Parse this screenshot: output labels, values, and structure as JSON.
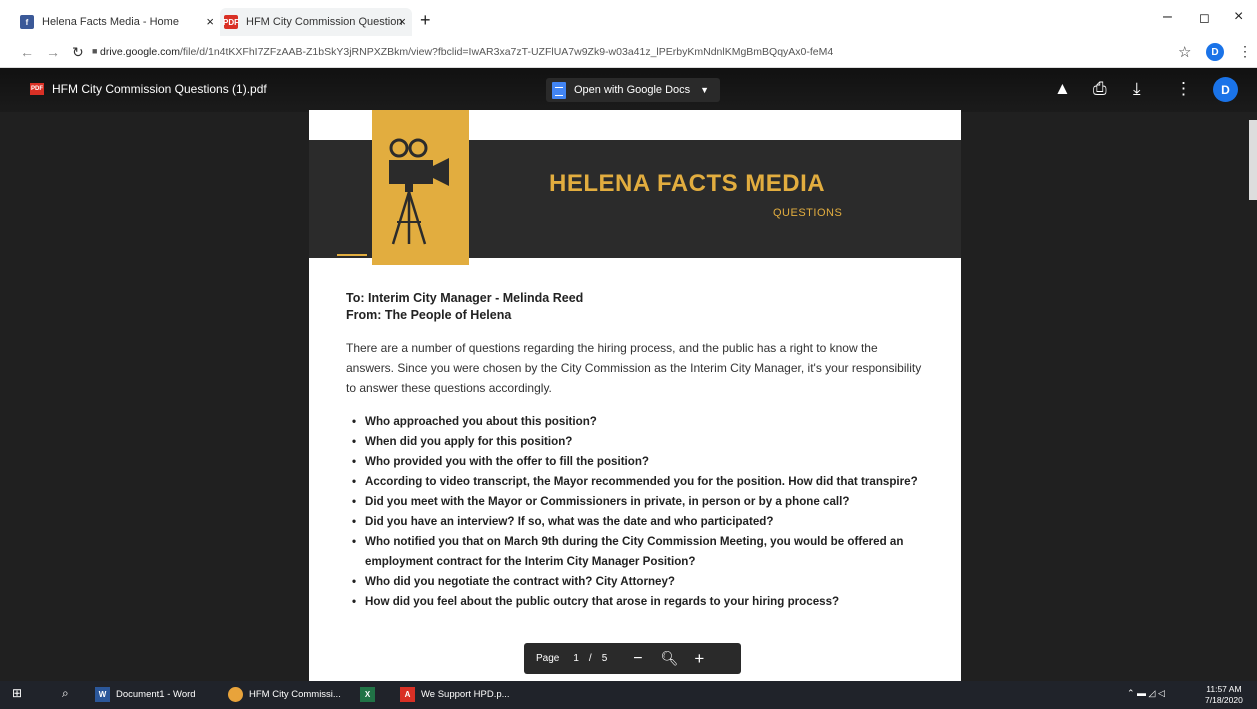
{
  "browser": {
    "tabs": [
      {
        "title": "Helena Facts Media - Home",
        "close": "×"
      },
      {
        "title": "HFM City Commission Question",
        "close": "×"
      }
    ],
    "new_tab": "+",
    "url_host": "drive.google.com",
    "url_path": "/file/d/1n4tKXFhI7ZFzAAB-Z1bSkY3jRNPXZBkm/view?fbclid=IwAR3xa7zT-UZFlUA7w9Zk9-w03a41z_lPErbyKmNdnlKMgBmBQqyAx0-feM4",
    "profile_initial": "D"
  },
  "viewer": {
    "file_name": "HFM City Commission Questions (1).pdf",
    "open_with": "Open with Google Docs",
    "profile_initial": "D",
    "pager": {
      "label": "Page",
      "current": "1",
      "sep": "/",
      "total": "5"
    }
  },
  "doc": {
    "brand": "HELENA FACTS MEDIA",
    "subtitle": "QUESTIONS",
    "to": "To: Interim City Manager - Melinda Reed",
    "from": "From: The People of Helena",
    "intro": "There are a number of questions regarding the hiring process, and the public has a right to know the answers. Since you were chosen by the City Commission as the Interim City Manager, it's your responsibility to answer these questions accordingly.",
    "questions": [
      "Who approached you about this position?",
      "When did you apply for this position?",
      "Who provided you with the offer to fill the position?",
      "According to video transcript, the Mayor recommended you for the position. How did that transpire?",
      "Did you meet with the Mayor or Commissioners in private, in person or by a phone call?",
      "Did you have an interview? If so, what was the date and who participated?",
      "Who notified you that on March 9th during the City Commission Meeting, you would be offered an employment contract for the Interim City Manager Position?",
      "Who did you negotiate the contract with? City Attorney?",
      "How did you feel about the public outcry that arose in regards to your hiring process?"
    ]
  },
  "taskbar": {
    "items": [
      "Document1 - Word",
      "HFM City Commissi...",
      "We Support HPD.p..."
    ],
    "time": "11:57 AM",
    "date": "7/18/2020"
  },
  "colors": {
    "gold": "#e2ad3f",
    "banner": "#2b2b2b",
    "viewer_bg": "#202020",
    "accent": "#1a73e8"
  }
}
